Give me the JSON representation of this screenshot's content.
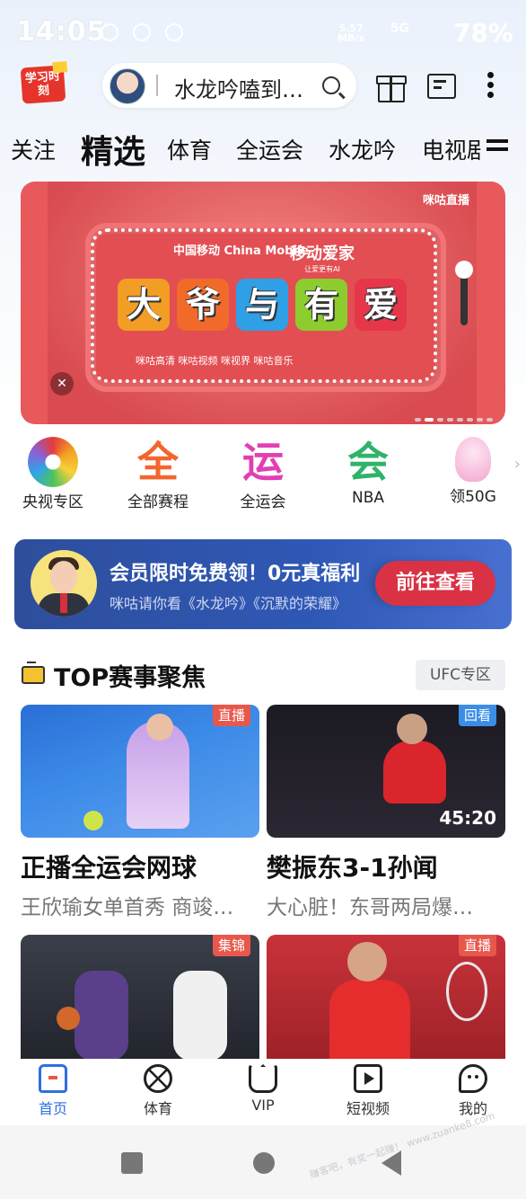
{
  "status": {
    "time": "14:05",
    "battery": "78%",
    "net_speed": "5.57",
    "net_unit": "MB/s",
    "signal": "5G"
  },
  "header": {
    "logo_text": "学习时刻",
    "search_text": "水龙吟嗑到…"
  },
  "tabs": [
    "关注",
    "精选",
    "体育",
    "全运会",
    "水龙吟",
    "电视剧"
  ],
  "banner": {
    "corner_logo": "咪咕直播",
    "brand_left": "中国移动 China Mobile",
    "brand_right": "移动爱家",
    "brand_right_sub": "让爱更有AI",
    "tiles": [
      "大",
      "爷",
      "与",
      "有",
      "爱"
    ],
    "partners": "咪咕高清  咪咕视频  咪视界  咪咕音乐",
    "mute_icon": "mute-icon"
  },
  "categories": [
    {
      "label": "央视专区",
      "icon": "cctv-icon"
    },
    {
      "label": "全部赛程",
      "icon": "全"
    },
    {
      "label": "全运会",
      "icon": "运"
    },
    {
      "label": "NBA",
      "icon": "会"
    },
    {
      "label": "领50G",
      "icon": "mascot-icon"
    }
  ],
  "member": {
    "title": "会员限时免费领！0元真福利",
    "subtitle": "咪咕请你看《水龙吟》《沉默的荣耀》",
    "button": "前往查看"
  },
  "section": {
    "title": "TOP赛事聚焦",
    "link": "UFC专区"
  },
  "cards": [
    {
      "tag": "直播",
      "tag_color": "#e8574b",
      "title": "正播全运会网球",
      "subtitle": "王欣瑜女单首秀 商竣…",
      "duration": ""
    },
    {
      "tag": "回看",
      "tag_color": "#3a8ee6",
      "title": "樊振东3-1孙闻",
      "subtitle": "大心脏！东哥两局爆…",
      "duration": "45:20"
    },
    {
      "tag": "集锦",
      "tag_color": "#e8574b",
      "title": "",
      "subtitle": "",
      "duration": ""
    },
    {
      "tag": "直播",
      "tag_color": "#e8574b",
      "title": "",
      "subtitle": "",
      "duration": ""
    }
  ],
  "nav": [
    {
      "label": "首页",
      "icon": "home-icon",
      "active": true
    },
    {
      "label": "体育",
      "icon": "basketball-icon",
      "active": false
    },
    {
      "label": "VIP",
      "icon": "vip-icon",
      "active": false
    },
    {
      "label": "短视频",
      "icon": "short-video-icon",
      "active": false
    },
    {
      "label": "我的",
      "icon": "profile-icon",
      "active": false
    }
  ],
  "watermark": "赚客吧，有奖一起赚！ www.zuanke8.com",
  "colors": {
    "accent": "#2f6fe0",
    "live_tag": "#e8574b",
    "replay_tag": "#3a8ee6",
    "member_button": "#d93245"
  }
}
